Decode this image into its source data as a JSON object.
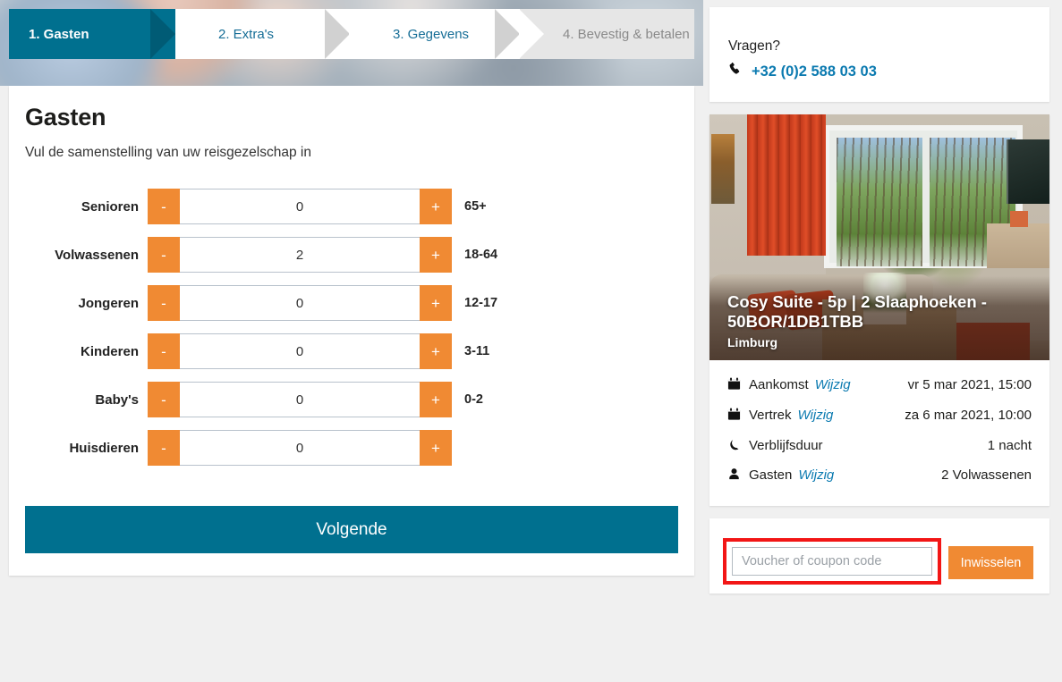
{
  "stepper": {
    "steps": [
      {
        "label": "1. Gasten",
        "state": "active"
      },
      {
        "label": "2. Extra's",
        "state": "available"
      },
      {
        "label": "3. Gegevens",
        "state": "available"
      },
      {
        "label": "4. Bevestig & betalen",
        "state": "disabled"
      }
    ]
  },
  "main": {
    "title": "Gasten",
    "subtitle": "Vul de samenstelling van uw reisgezelschap in",
    "minus_label": "-",
    "plus_label": "+",
    "counters": [
      {
        "label": "Senioren",
        "value": "0",
        "range": "65+"
      },
      {
        "label": "Volwassenen",
        "value": "2",
        "range": "18-64"
      },
      {
        "label": "Jongeren",
        "value": "0",
        "range": "12-17"
      },
      {
        "label": "Kinderen",
        "value": "0",
        "range": "3-11"
      },
      {
        "label": "Baby's",
        "value": "0",
        "range": "0-2"
      },
      {
        "label": "Huisdieren",
        "value": "0",
        "range": ""
      }
    ],
    "next_label": "Volgende"
  },
  "contact": {
    "title": "Vragen?",
    "phone": "+32 (0)2 588 03 03",
    "phone_icon": "phone-icon"
  },
  "property": {
    "title": "Cosy Suite - 5p | 2 Slaaphoeken - 50BOR/1DB1TBB",
    "location": "Limburg",
    "details": [
      {
        "icon": "calendar-icon",
        "label": "Aankomst",
        "change": "Wijzig",
        "value": "vr 5 mar 2021, 15:00"
      },
      {
        "icon": "calendar-icon",
        "label": "Vertrek",
        "change": "Wijzig",
        "value": "za 6 mar 2021, 10:00"
      },
      {
        "icon": "moon-icon",
        "label": "Verblijfsduur",
        "change": "",
        "value": "1 nacht"
      },
      {
        "icon": "person-icon",
        "label": "Gasten",
        "change": "Wijzig",
        "value": "2 Volwassenen"
      }
    ]
  },
  "voucher": {
    "placeholder": "Voucher of coupon code",
    "value": "",
    "button_label": "Inwisselen"
  },
  "colors": {
    "teal": "#00708F",
    "orange": "#F08A33",
    "link_blue": "#0b7ab0",
    "highlight_red": "#f21616",
    "page_bg": "#f0f0f0"
  }
}
